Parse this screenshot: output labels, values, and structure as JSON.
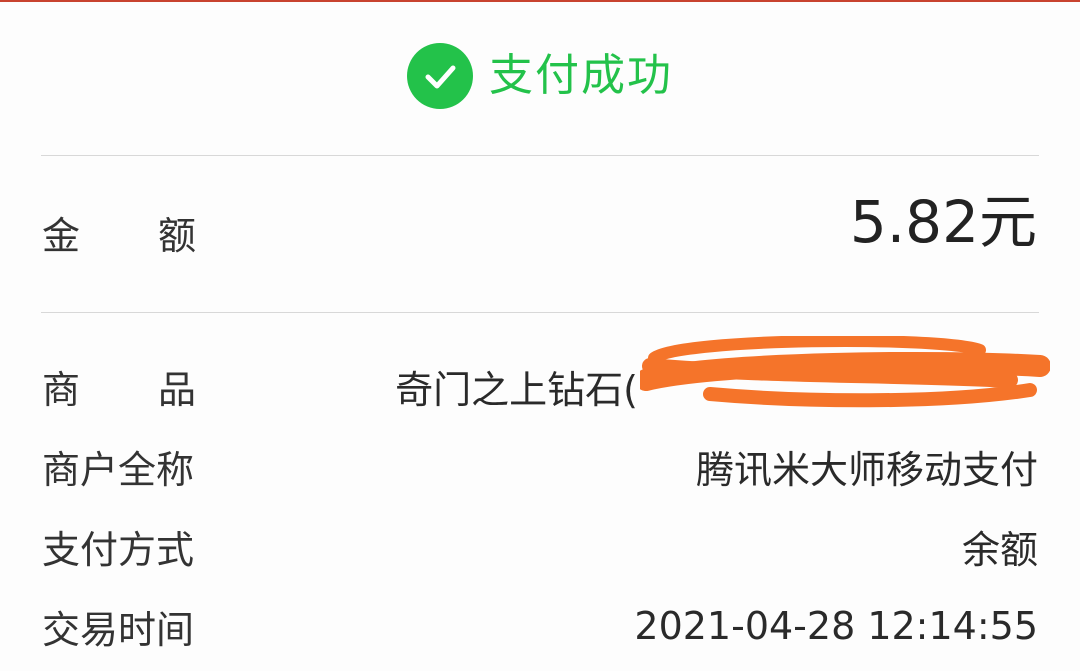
{
  "status": {
    "title": "支付成功",
    "icon": "check-circle-icon",
    "color": "#23c24a"
  },
  "amount": {
    "label_1": "金",
    "label_2": "额",
    "value": "5.82元"
  },
  "details": {
    "product_label_1": "商",
    "product_label_2": "品",
    "product_value": "奇门之上钻石(",
    "merchant_label": "商户全称",
    "merchant_value": "腾讯米大师移动支付",
    "method_label": "支付方式",
    "method_value": "余额",
    "time_label": "交易时间",
    "time_value": "2021-04-28 12:14:55"
  },
  "redaction_color": "#f5742a"
}
